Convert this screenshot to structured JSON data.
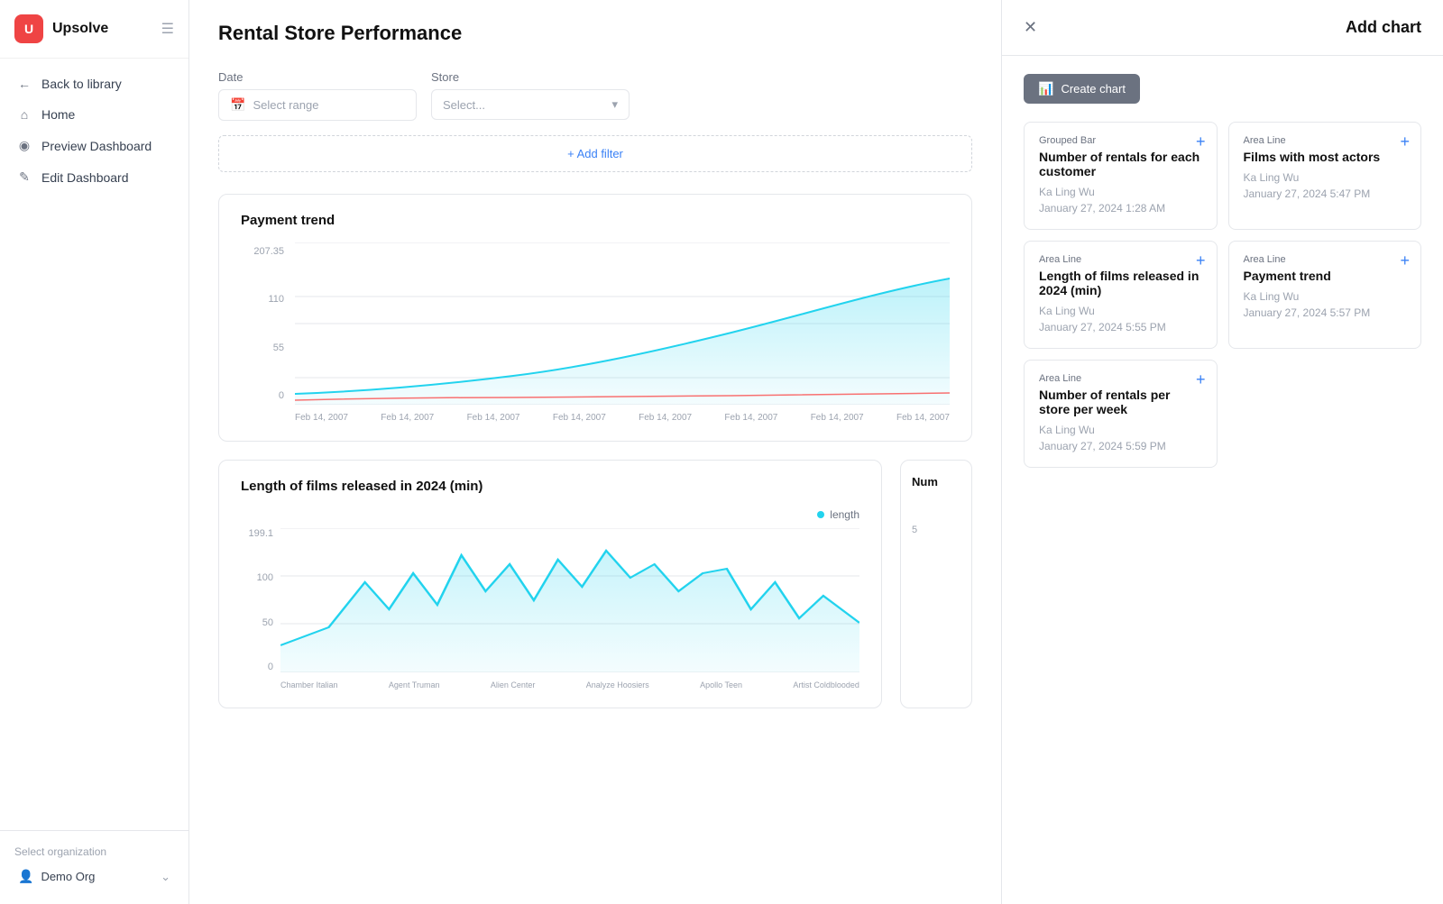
{
  "app": {
    "name": "Upsolve",
    "logo_letter": "U"
  },
  "sidebar": {
    "toggle_icon": "☰",
    "nav_items": [
      {
        "id": "back",
        "label": "Back to library",
        "icon": "←"
      },
      {
        "id": "home",
        "label": "Home",
        "icon": "⌂"
      },
      {
        "id": "preview",
        "label": "Preview Dashboard",
        "icon": "◉"
      },
      {
        "id": "edit",
        "label": "Edit Dashboard",
        "icon": "✎"
      }
    ],
    "org_section": {
      "label": "Select organization",
      "name": "Demo Org",
      "icon": "👤"
    }
  },
  "main": {
    "page_title": "Rental Store Performance",
    "filters": {
      "date_label": "Date",
      "date_placeholder": "Select range",
      "store_label": "Store",
      "store_placeholder": "Select...",
      "add_filter_label": "+ Add filter"
    },
    "charts": [
      {
        "id": "payment_trend",
        "title": "Payment trend",
        "y_labels": [
          "207.35",
          "110",
          "55",
          "0"
        ],
        "x_labels": [
          "Feb 14, 2007",
          "Feb 14, 2007",
          "Feb 14, 2007",
          "Feb 14, 2007",
          "Feb 14, 2007",
          "Feb 14, 2007",
          "Feb 14, 2007",
          "Feb 14, 2007"
        ]
      },
      {
        "id": "length_films",
        "title": "Length of films released in 2024 (min)",
        "legend_label": "length",
        "y_labels": [
          "199.1",
          "100",
          "50",
          "0"
        ],
        "x_labels": [
          "Chamber Italian",
          "Agent Truman",
          "Alien Center",
          "Analyze Hoosiers",
          "Apollo Teen",
          "Artist Coldblooded"
        ]
      },
      {
        "id": "num_rentals",
        "title": "Num",
        "y_labels": [
          "5"
        ],
        "x_labels": []
      }
    ]
  },
  "right_panel": {
    "title": "Add chart",
    "close_icon": "✕",
    "create_chart_label": "Create chart",
    "chart_icon": "📊",
    "chart_items": [
      {
        "type": "Grouped Bar",
        "title": "Number of rentals for each customer",
        "author": "Ka Ling Wu",
        "date": "January 27, 2024 1:28 AM"
      },
      {
        "type": "Area Line",
        "title": "Films with most actors",
        "author": "Ka Ling Wu",
        "date": "January 27, 2024 5:47 PM"
      },
      {
        "type": "Area Line",
        "title": "Length of films released in 2024 (min)",
        "author": "Ka Ling Wu",
        "date": "January 27, 2024 5:55 PM"
      },
      {
        "type": "Area Line",
        "title": "Payment trend",
        "author": "Ka Ling Wu",
        "date": "January 27, 2024 5:57 PM"
      },
      {
        "type": "Area Line",
        "title": "Number of rentals per store per week",
        "author": "Ka Ling Wu",
        "date": "January 27, 2024 5:59 PM"
      }
    ]
  }
}
